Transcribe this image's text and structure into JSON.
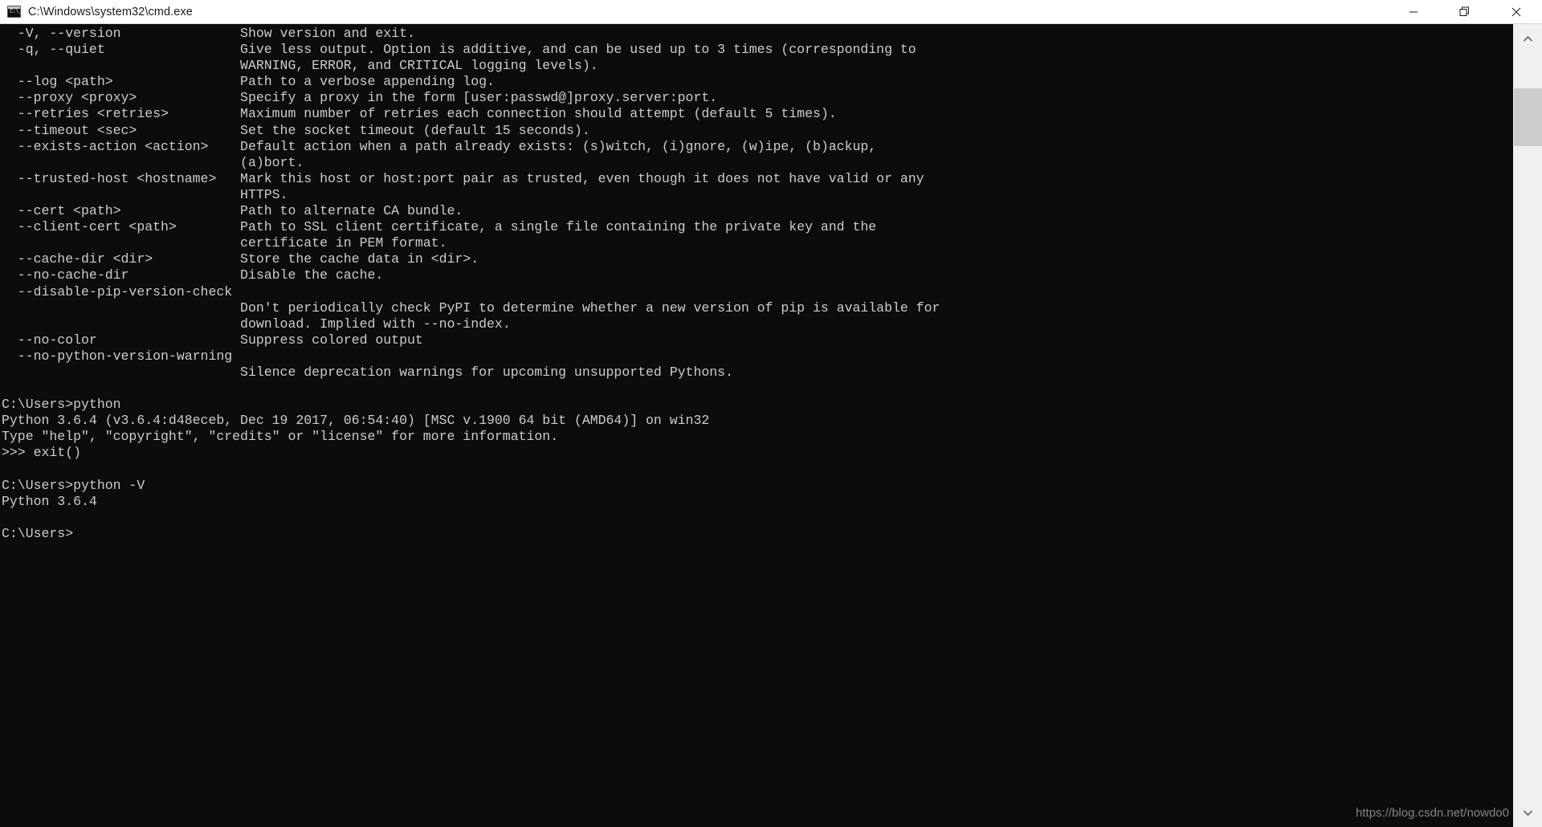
{
  "window": {
    "title": "C:\\Windows\\system32\\cmd.exe",
    "icon": "cmd-icon",
    "icon_glyph": "C:\\_",
    "background_color": "#0c0c0c",
    "foreground_color": "#cccccc",
    "titlebar_color": "#ffffff"
  },
  "titlebar_buttons": {
    "minimize": "minimize-icon",
    "maximize": "restore-icon",
    "close": "close-icon"
  },
  "scrollbar": {
    "up_arrow": "chevron-up-icon",
    "down_arrow": "chevron-down-icon",
    "thumb": "scrollbar-thumb"
  },
  "watermark": {
    "text": "https://blog.csdn.net/nowdo0"
  },
  "terminal": {
    "lines": [
      "  -V, --version               Show version and exit.",
      "  -q, --quiet                 Give less output. Option is additive, and can be used up to 3 times (corresponding to",
      "                              WARNING, ERROR, and CRITICAL logging levels).",
      "  --log <path>                Path to a verbose appending log.",
      "  --proxy <proxy>             Specify a proxy in the form [user:passwd@]proxy.server:port.",
      "  --retries <retries>         Maximum number of retries each connection should attempt (default 5 times).",
      "  --timeout <sec>             Set the socket timeout (default 15 seconds).",
      "  --exists-action <action>    Default action when a path already exists: (s)witch, (i)gnore, (w)ipe, (b)ackup,",
      "                              (a)bort.",
      "  --trusted-host <hostname>   Mark this host or host:port pair as trusted, even though it does not have valid or any",
      "                              HTTPS.",
      "  --cert <path>               Path to alternate CA bundle.",
      "  --client-cert <path>        Path to SSL client certificate, a single file containing the private key and the",
      "                              certificate in PEM format.",
      "  --cache-dir <dir>           Store the cache data in <dir>.",
      "  --no-cache-dir              Disable the cache.",
      "  --disable-pip-version-check",
      "                              Don't periodically check PyPI to determine whether a new version of pip is available for",
      "                              download. Implied with --no-index.",
      "  --no-color                  Suppress colored output",
      "  --no-python-version-warning",
      "                              Silence deprecation warnings for upcoming unsupported Pythons.",
      "",
      "C:\\Users>python",
      "Python 3.6.4 (v3.6.4:d48eceb, Dec 19 2017, 06:54:40) [MSC v.1900 64 bit (AMD64)] on win32",
      "Type \"help\", \"copyright\", \"credits\" or \"license\" for more information.",
      ">>> exit()",
      "",
      "C:\\Users>python -V",
      "Python 3.6.4",
      "",
      "C:\\Users>"
    ]
  }
}
